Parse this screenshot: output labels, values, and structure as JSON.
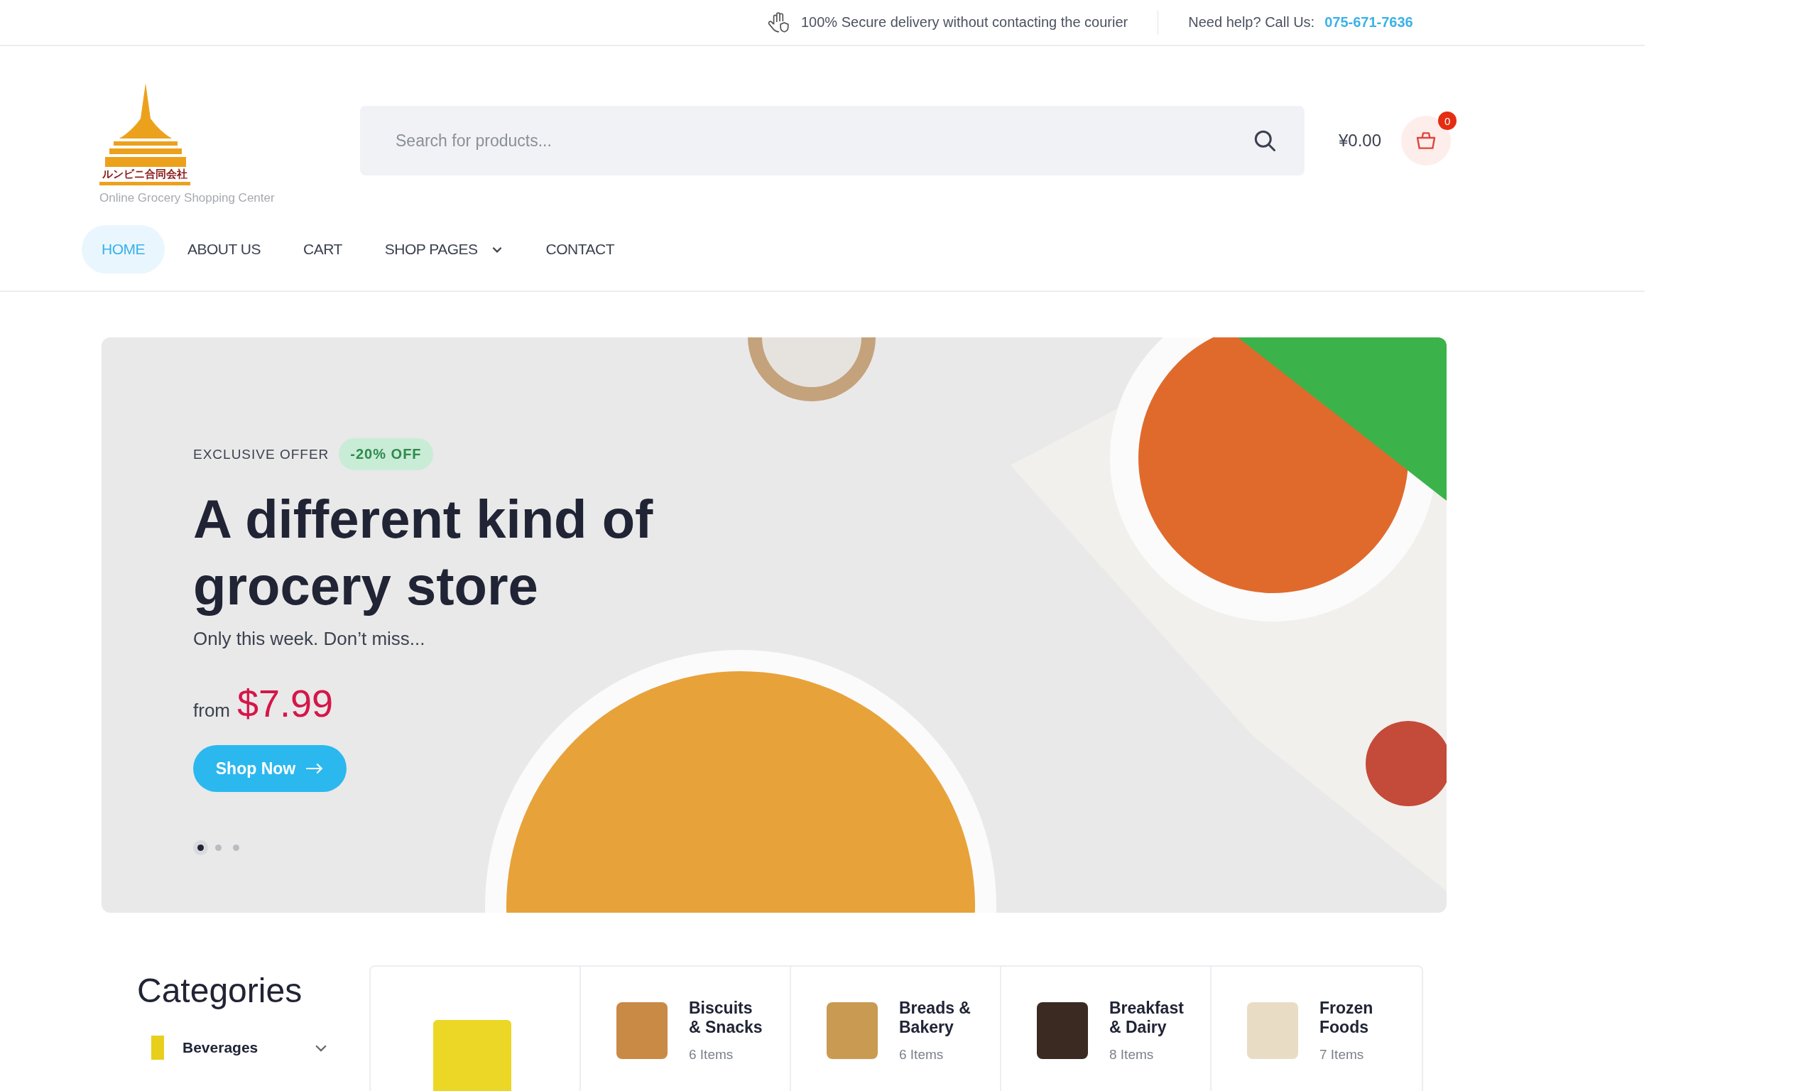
{
  "top_bar": {
    "notice": "100% Secure delivery without contacting the courier",
    "help_label": "Need help? Call Us:",
    "phone": "075-671-7636"
  },
  "header": {
    "logo_text": "ルンビニ合同会社",
    "tagline": "Online Grocery Shopping Center",
    "search": {
      "placeholder": "Search for products..."
    },
    "cart_total": "¥0.00",
    "cart_count": "0"
  },
  "nav": [
    {
      "label": "HOME",
      "selected": true,
      "dropdown": false
    },
    {
      "label": "ABOUT US",
      "selected": false,
      "dropdown": false
    },
    {
      "label": "CART",
      "selected": false,
      "dropdown": false
    },
    {
      "label": "SHOP PAGES",
      "selected": false,
      "dropdown": true
    },
    {
      "label": "CONTACT",
      "selected": false,
      "dropdown": false
    }
  ],
  "hero": {
    "eyebrow": "EXCLUSIVE OFFER",
    "badge": "-20% OFF",
    "title": "A different kind of grocery store",
    "subtitle": "Only this week. Don’t miss...",
    "price_prefix": "from",
    "price": "$7.99",
    "button": "Shop Now",
    "slides": [
      {
        "selected": true
      },
      {
        "selected": false
      },
      {
        "selected": false
      }
    ]
  },
  "categories": {
    "title": "Categories",
    "sidebar": [
      {
        "label": "Beverages",
        "expanded": false
      }
    ],
    "items": [
      {
        "kind": "image_only"
      },
      {
        "kind": "labeled",
        "name": "Biscuits & Snacks",
        "count": "6 Items"
      },
      {
        "kind": "labeled",
        "name": "Breads & Bakery",
        "count": "6 Items"
      },
      {
        "kind": "labeled",
        "name": "Breakfast & Dairy",
        "count": "8 Items"
      },
      {
        "kind": "labeled",
        "name": "Frozen Foods",
        "count": "7 Items"
      }
    ]
  }
}
